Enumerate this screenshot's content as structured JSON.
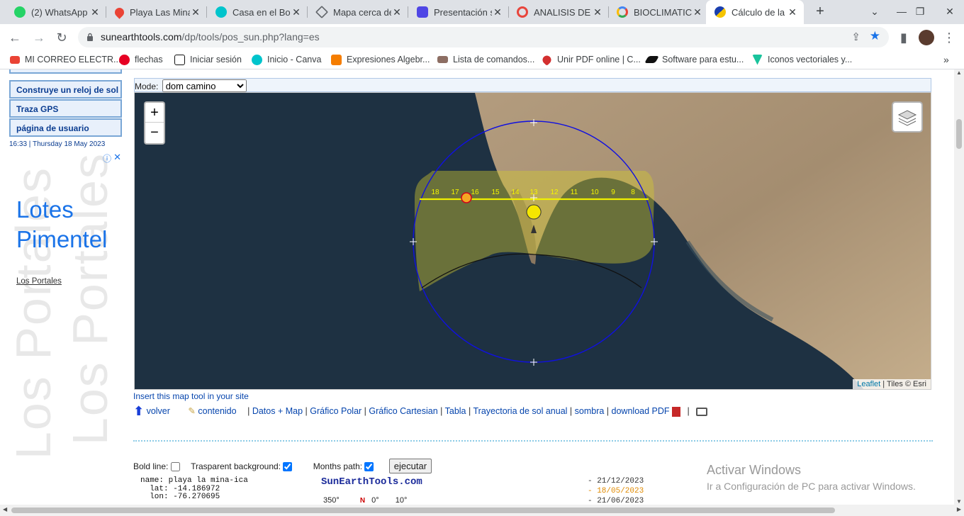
{
  "tabs": [
    {
      "title": "(2) WhatsApp",
      "icon": "whatsapp-icon",
      "color": "#25d366"
    },
    {
      "title": "Playa Las Minas",
      "icon": "maps-pin-icon",
      "color": "#ea4335"
    },
    {
      "title": "Casa en el Bosque",
      "icon": "canva-icon",
      "color": "#00c4cc"
    },
    {
      "title": "Mapa cerca de",
      "icon": "cube-icon",
      "color": "#5f6368"
    },
    {
      "title": "Presentación s",
      "icon": "presentation-icon",
      "color": "#4f46e5"
    },
    {
      "title": "ANALISIS DE T",
      "icon": "target-icon",
      "color": "#e8453c"
    },
    {
      "title": "BIOCLIMATICA",
      "icon": "google-icon",
      "color": "#4285f4"
    },
    {
      "title": "Cálculo de la p",
      "icon": "sun-path-icon",
      "color": "#f5c400"
    }
  ],
  "address": {
    "domain": "sunearthtools.com",
    "path": "/dp/tools/pos_sun.php?lang=es"
  },
  "bookmarks": [
    {
      "label": "MI CORREO ELECTR...",
      "icon": "gmail-icon",
      "color": "#ea4335"
    },
    {
      "label": "flechas",
      "icon": "pinterest-icon",
      "color": "#e60023"
    },
    {
      "label": "Iniciar sesión",
      "icon": "notion-icon",
      "color": "#111111"
    },
    {
      "label": "Inicio - Canva",
      "icon": "canva-icon",
      "color": "#00c4cc"
    },
    {
      "label": "Expresiones Algebr...",
      "icon": "blogger-icon",
      "color": "#f57d00"
    },
    {
      "label": "Lista de comandos...",
      "icon": "ship-icon",
      "color": "#8d6e63"
    },
    {
      "label": "Unir PDF online | C...",
      "icon": "heart-icon",
      "color": "#d32f2f"
    },
    {
      "label": "Software para estu...",
      "icon": "autodesk-icon",
      "color": "#111111"
    },
    {
      "label": "Iconos vectoriales y...",
      "icon": "vector-icon",
      "color": "#19c39c"
    }
  ],
  "sidebar": {
    "items": [
      "Construye un reloj de sol",
      "Traza GPS",
      "página de usuario"
    ],
    "timestamp": "16:33 | Thursday 18 May 2023",
    "ad": {
      "title_line1": "Lotes",
      "title_line2": "Pimentel",
      "link": "Los Portales",
      "bg_text": "Los Portales"
    }
  },
  "mode": {
    "label": "Mode:",
    "selected": "dom camino"
  },
  "map": {
    "zoom_in": "+",
    "zoom_out": "−",
    "hour_labels": [
      "18",
      "17",
      "16",
      "15",
      "14",
      "13",
      "12",
      "11",
      "10",
      "9",
      "8"
    ],
    "attribution_link": "Leaflet",
    "attribution_text": "| Tiles © Esri"
  },
  "insert_link": "Insert this map tool in your site",
  "nav": {
    "volver": "volver",
    "contenido": "contenido",
    "links": [
      "Datos + Map",
      "Gráfico Polar",
      "Gráfico Cartesian",
      "Tabla",
      "Trayectoria de sol anual",
      "sombra",
      "download PDF"
    ]
  },
  "controls": {
    "bold_line": "Bold line:",
    "transparent_bg": "Trasparent background:",
    "months_path": "Months path:",
    "run": "ejecutar"
  },
  "info": {
    "name": "name: playa la mina-ica",
    "lat": "  lat: -14.186972",
    "lon": "  lon: -76.270695",
    "site": "SunEarthTools.com",
    "deg_350": "350°",
    "north": "N",
    "deg_0": "0°",
    "deg_10": "10°",
    "dates": [
      "- 21/12/2023",
      "- 18/05/2023",
      "- 21/06/2023"
    ],
    "date_colors": [
      "#333333",
      "#e08a00",
      "#333333"
    ]
  },
  "watermark": {
    "title": "Activar Windows",
    "subtitle": "Ir a Configuración de PC para activar Windows."
  }
}
